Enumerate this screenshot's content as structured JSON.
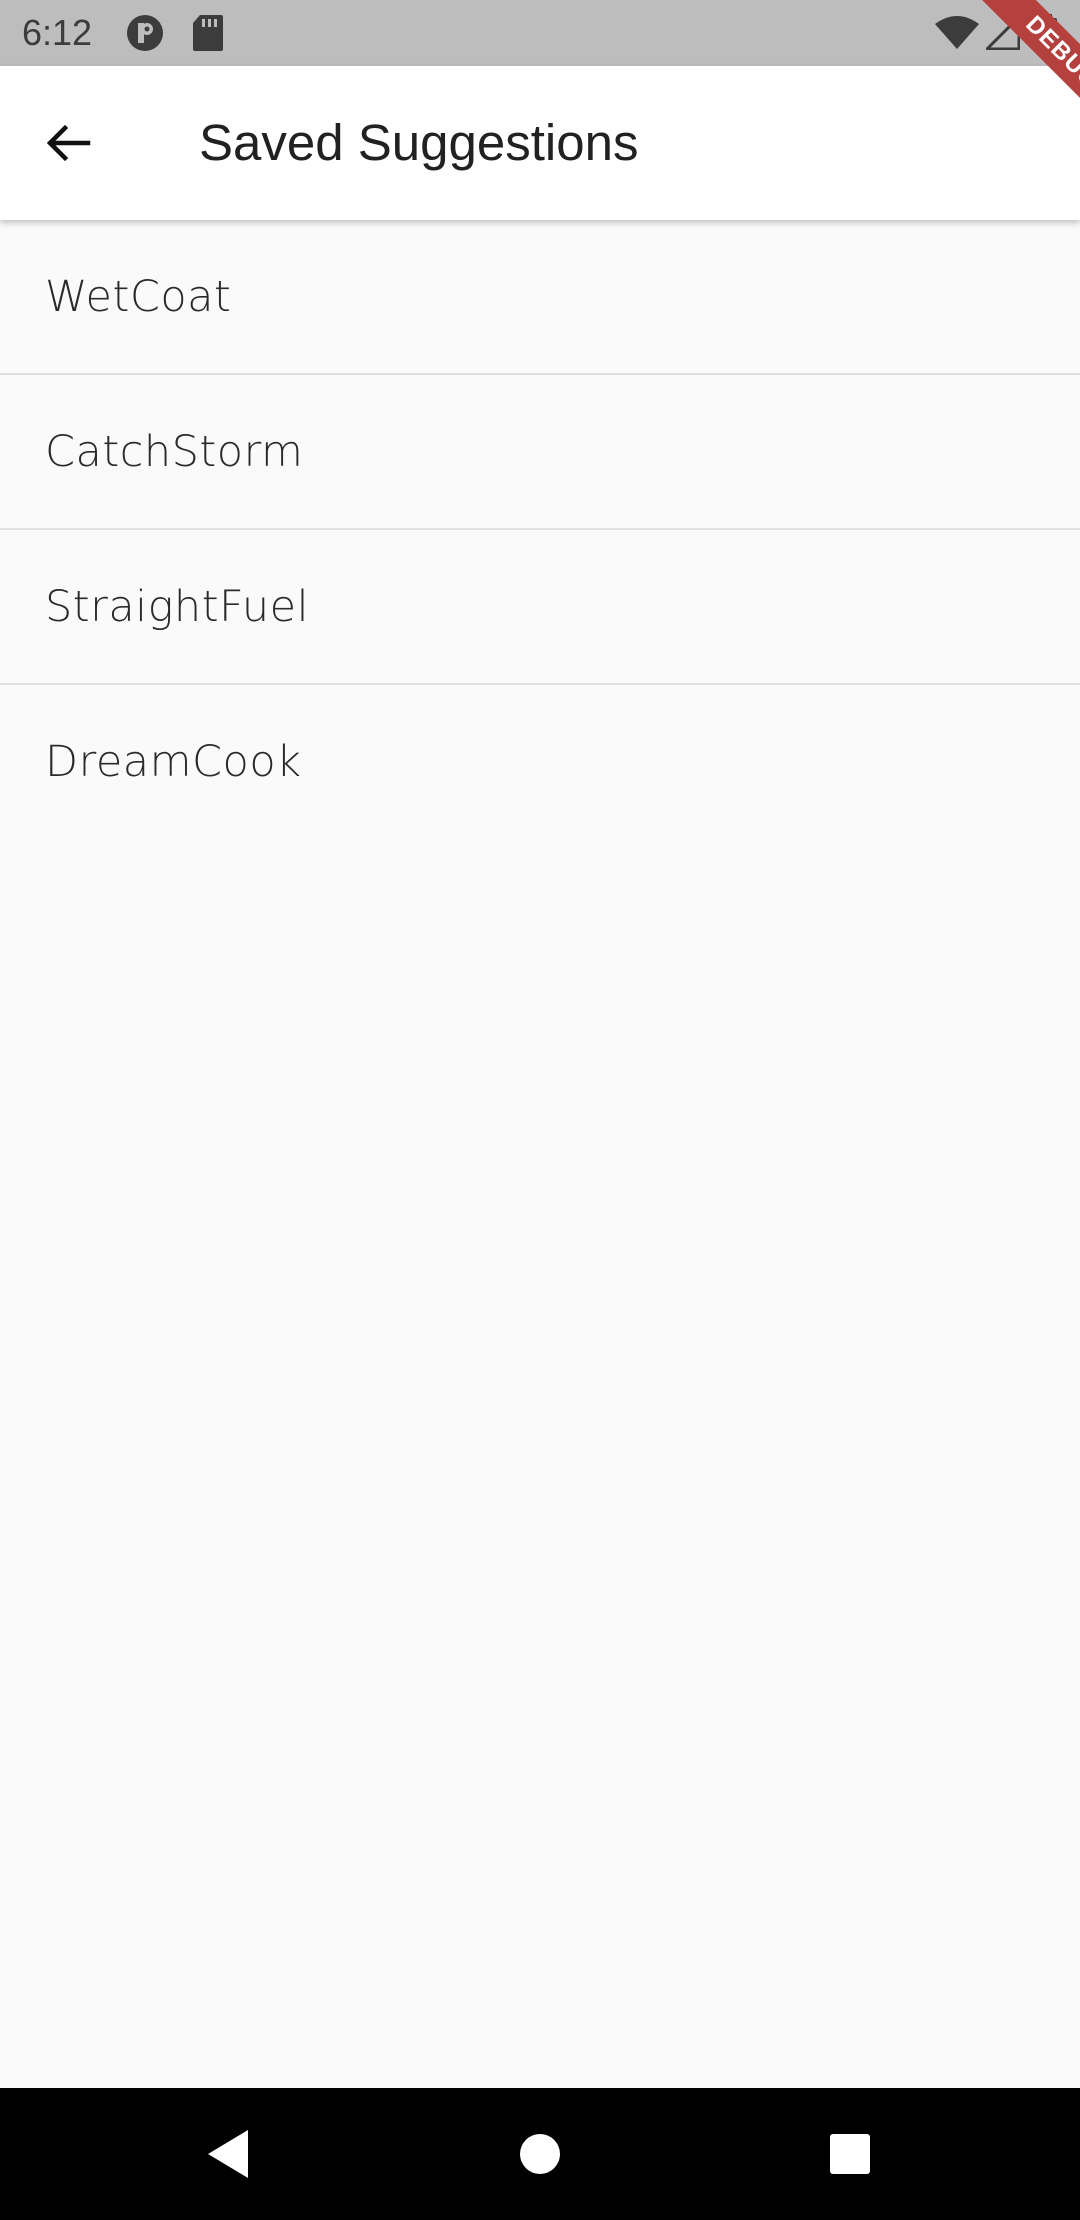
{
  "status_bar": {
    "time": "6:12"
  },
  "debug_banner": "DEBUG",
  "app_bar": {
    "title": "Saved Suggestions",
    "back_icon": "arrow-back-icon"
  },
  "saved_suggestions": [
    "WetCoat",
    "CatchStorm",
    "StraightFuel",
    "DreamCook"
  ],
  "nav_bar": {
    "back": "nav-back-icon",
    "home": "nav-home-icon",
    "recents": "nav-recents-icon"
  }
}
